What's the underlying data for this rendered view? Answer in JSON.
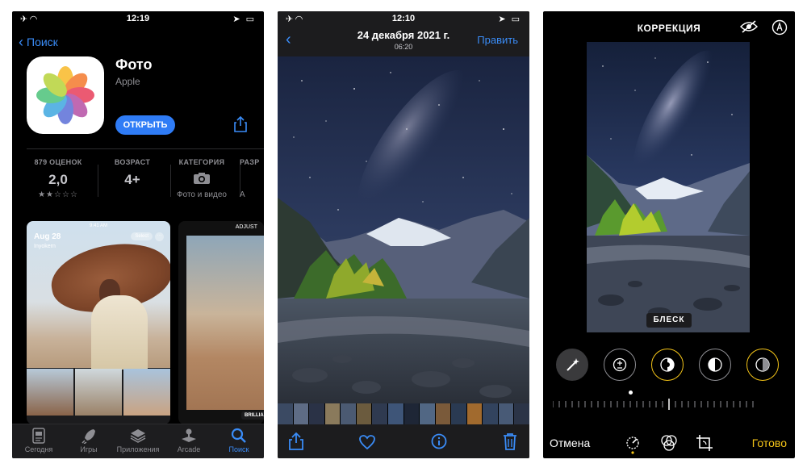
{
  "appstore": {
    "status_time": "12:19",
    "back_label": "Поиск",
    "app_name": "Фото",
    "developer": "Apple",
    "get_label": "ОТКРЫТЬ",
    "info": [
      {
        "label": "879 ОЦЕНОК",
        "value": "2,0",
        "sub": "★★☆☆☆"
      },
      {
        "label": "ВОЗРАСТ",
        "value": "4+",
        "sub": ""
      },
      {
        "label": "КАТЕГОРИЯ",
        "value": "",
        "sub": "Фото и видео"
      },
      {
        "label": "РАЗР",
        "value": "",
        "sub": "А"
      }
    ],
    "rating_value": 2,
    "rating_max": 5,
    "screenshot1": {
      "time": "9:41 AM",
      "date": "Aug 28",
      "location": "Inyokern",
      "select": "Select"
    },
    "screenshot2": {
      "header": "ADJUST",
      "badge": "BRILLIANCE"
    },
    "tabs": [
      {
        "label": "Сегодня",
        "icon": "today-icon"
      },
      {
        "label": "Игры",
        "icon": "rocket-icon"
      },
      {
        "label": "Приложения",
        "icon": "apps-stack-icon"
      },
      {
        "label": "Arcade",
        "icon": "joystick-icon"
      },
      {
        "label": "Поиск",
        "icon": "search-icon"
      }
    ],
    "active_tab": "Поиск",
    "accent": "#2f7cf6"
  },
  "viewer": {
    "status_time": "12:10",
    "title": "24 декабря 2021 г.",
    "subtitle": "06:20",
    "edit_label": "Править",
    "accent": "#3a8cf7"
  },
  "editor": {
    "title": "КОРРЕКЦИЯ",
    "badge": "БЛЕСК",
    "cancel_label": "Отмена",
    "done_label": "Готово",
    "done_color": "#f5c518"
  }
}
